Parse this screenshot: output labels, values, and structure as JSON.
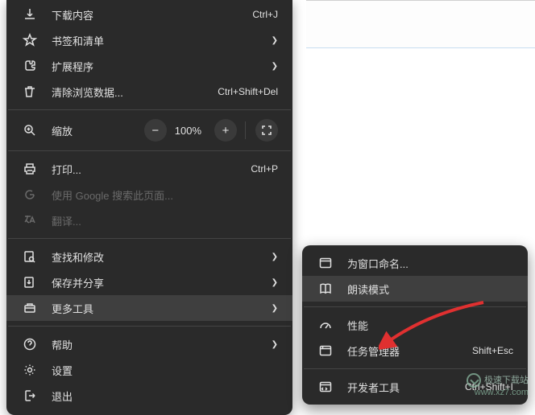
{
  "main_menu": {
    "downloads": {
      "label": "下载内容",
      "accel": "Ctrl+J"
    },
    "bookmarks": {
      "label": "书签和清单"
    },
    "extensions": {
      "label": "扩展程序"
    },
    "clear_data": {
      "label": "清除浏览数据...",
      "accel": "Ctrl+Shift+Del"
    },
    "zoom": {
      "label": "缩放",
      "value": "100%"
    },
    "print": {
      "label": "打印...",
      "accel": "Ctrl+P"
    },
    "google_search": {
      "label": "使用 Google 搜索此页面..."
    },
    "translate": {
      "label": "翻译..."
    },
    "find_edit": {
      "label": "查找和修改"
    },
    "save_share": {
      "label": "保存并分享"
    },
    "more_tools": {
      "label": "更多工具"
    },
    "help": {
      "label": "帮助"
    },
    "settings": {
      "label": "设置"
    },
    "exit": {
      "label": "退出"
    }
  },
  "submenu": {
    "name_window": {
      "label": "为窗口命名..."
    },
    "reading_mode": {
      "label": "朗读模式"
    },
    "performance": {
      "label": "性能"
    },
    "task_manager": {
      "label": "任务管理器",
      "accel": "Shift+Esc"
    },
    "dev_tools": {
      "label": "开发者工具",
      "accel": "Ctrl+Shift+I"
    }
  },
  "watermark": {
    "line1": "极速下载站",
    "line2": "www.xz7.com"
  }
}
